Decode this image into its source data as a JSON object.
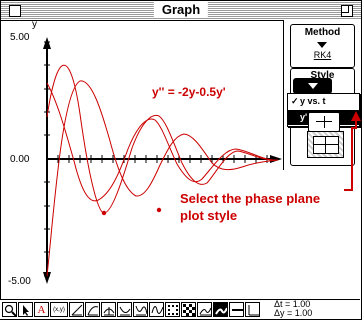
{
  "window": {
    "title": "Graph"
  },
  "plot": {
    "y_axis_label": "y",
    "y_max_label": "5.00",
    "y_zero_label": "0.00",
    "y_min_label": "-5.00",
    "equation": "y'' = -2y-0.5y'",
    "curve_color": "#cc0000"
  },
  "panel": {
    "method_title": "Method",
    "method_value": "RK4",
    "style_title": "Style",
    "style_menu": [
      {
        "check": "✓",
        "label": "y vs. t",
        "selected": false
      },
      {
        "check": "",
        "label": "y' vs. y",
        "selected": true
      }
    ]
  },
  "annotation": {
    "line1": "Select the phase plane",
    "line2": "plot style",
    "color": "#cc0000"
  },
  "toolbar": {
    "tools": [
      "magnifier-icon",
      "arrow-cursor-icon",
      "text-tool-icon",
      "coordinates-tool-icon",
      "line-tool-icon",
      "slope-tool-icon",
      "tangent-tool-icon",
      "area-tool-icon",
      "inflection-tool-icon",
      "wave-tool-icon",
      "grid-dots-icon",
      "grid-pattern-icon",
      "curve-plot-icon",
      "thick-line-icon"
    ],
    "coords_label": "(x,y)",
    "text_label": "A",
    "dt_label": "Δt = 1.00",
    "dy_label": "Δy = 1.00"
  }
}
